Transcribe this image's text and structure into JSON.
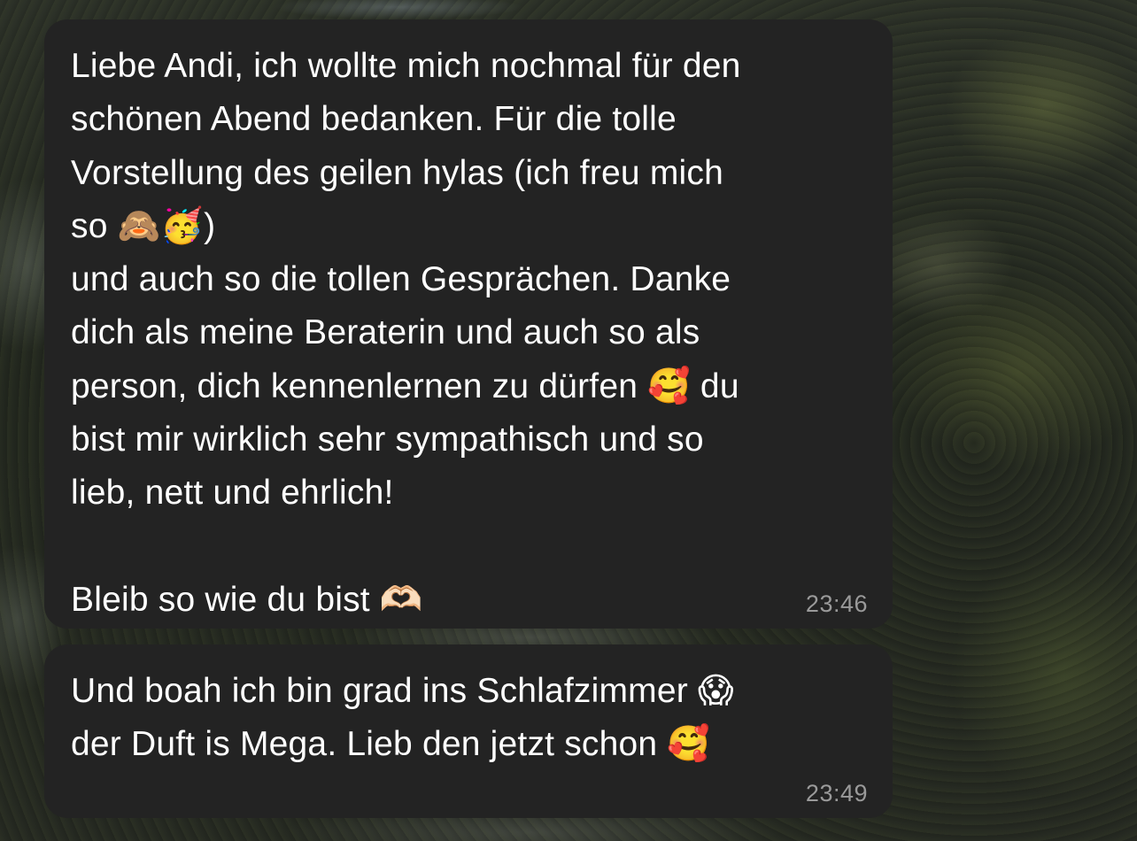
{
  "messages": [
    {
      "text": "Liebe Andi, ich wollte mich nochmal für den\nschönen Abend bedanken. Für die tolle\nVorstellung des geilen hylas (ich freu mich\nso 🙈🥳)\nund auch so die tollen Gesprächen. Danke\ndich als meine Beraterin und auch so als\nperson, dich kennenlernen zu dürfen 🥰 du\nbist mir wirklich sehr sympathisch und so\nlieb, nett und ehrlich!\n\nBleib so wie du bist 🫶🏻",
      "time": "23:46"
    },
    {
      "text": "Und boah ich bin grad ins Schlafzimmer 😱\nder Duft is Mega. Lieb den jetzt schon 🥰",
      "time": "23:49"
    }
  ],
  "colors": {
    "bubble": "#232323",
    "text": "#ffffff",
    "timestamp": "#9a9a9a"
  }
}
